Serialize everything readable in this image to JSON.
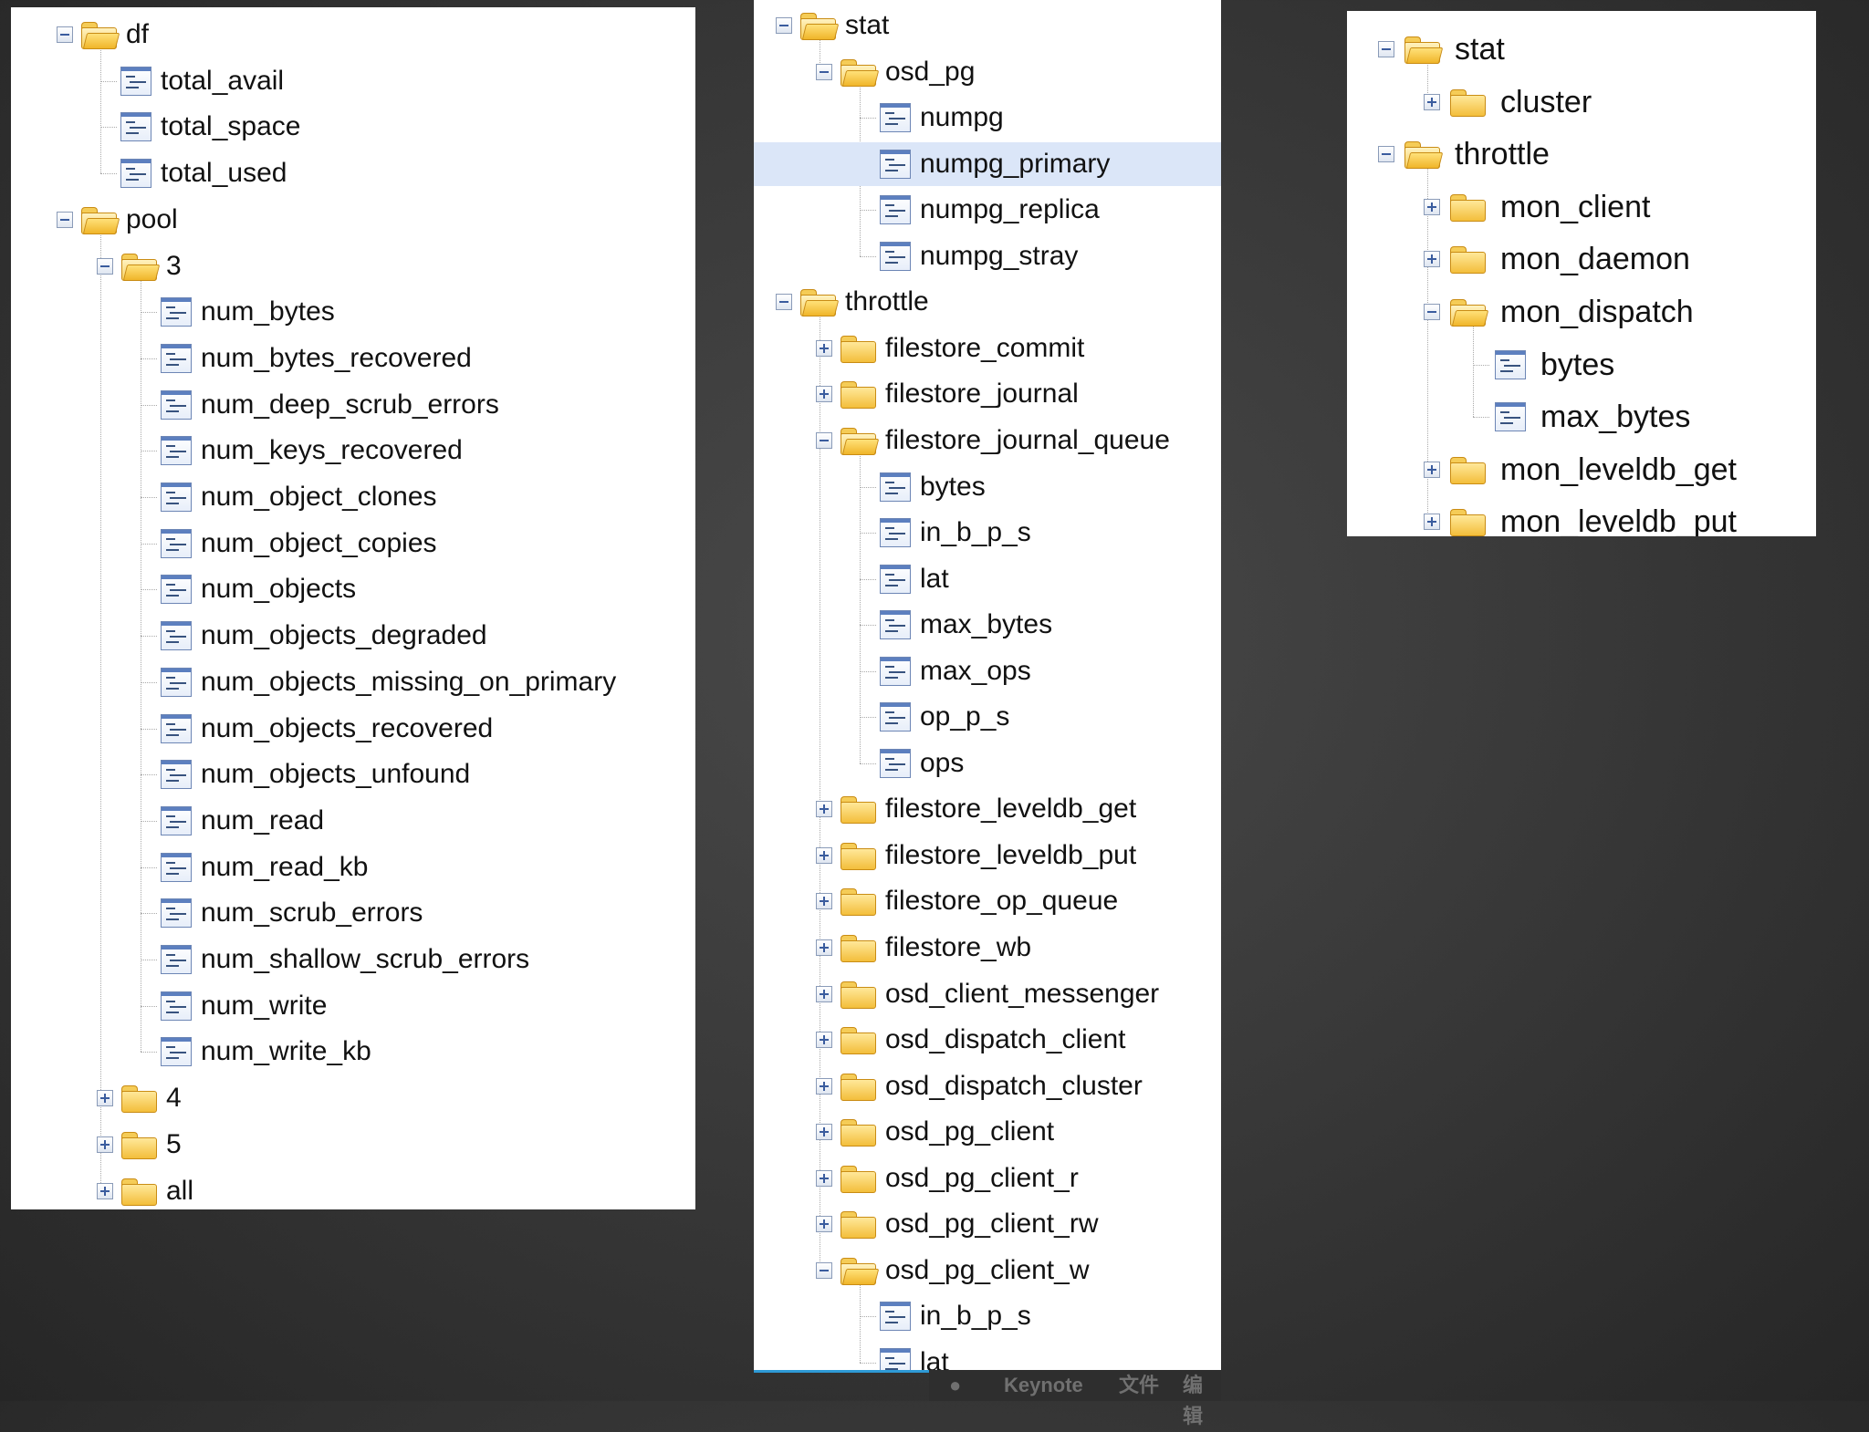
{
  "panels": [
    {
      "id": "panel-1",
      "rows": [
        {
          "label": "df",
          "type": "folder",
          "depth": 0,
          "toggle": "minus"
        },
        {
          "label": "total_avail",
          "type": "file",
          "depth": 1
        },
        {
          "label": "total_space",
          "type": "file",
          "depth": 1
        },
        {
          "label": "total_used",
          "type": "file",
          "depth": 1
        },
        {
          "label": "pool",
          "type": "folder",
          "depth": 0,
          "toggle": "minus"
        },
        {
          "label": "3",
          "type": "folder",
          "depth": 1,
          "toggle": "minus"
        },
        {
          "label": "num_bytes",
          "type": "file",
          "depth": 2
        },
        {
          "label": "num_bytes_recovered",
          "type": "file",
          "depth": 2
        },
        {
          "label": "num_deep_scrub_errors",
          "type": "file",
          "depth": 2
        },
        {
          "label": "num_keys_recovered",
          "type": "file",
          "depth": 2
        },
        {
          "label": "num_object_clones",
          "type": "file",
          "depth": 2
        },
        {
          "label": "num_object_copies",
          "type": "file",
          "depth": 2
        },
        {
          "label": "num_objects",
          "type": "file",
          "depth": 2
        },
        {
          "label": "num_objects_degraded",
          "type": "file",
          "depth": 2
        },
        {
          "label": "num_objects_missing_on_primary",
          "type": "file",
          "depth": 2
        },
        {
          "label": "num_objects_recovered",
          "type": "file",
          "depth": 2
        },
        {
          "label": "num_objects_unfound",
          "type": "file",
          "depth": 2
        },
        {
          "label": "num_read",
          "type": "file",
          "depth": 2
        },
        {
          "label": "num_read_kb",
          "type": "file",
          "depth": 2
        },
        {
          "label": "num_scrub_errors",
          "type": "file",
          "depth": 2
        },
        {
          "label": "num_shallow_scrub_errors",
          "type": "file",
          "depth": 2
        },
        {
          "label": "num_write",
          "type": "file",
          "depth": 2
        },
        {
          "label": "num_write_kb",
          "type": "file",
          "depth": 2
        },
        {
          "label": "4",
          "type": "folder",
          "depth": 1,
          "toggle": "plus"
        },
        {
          "label": "5",
          "type": "folder",
          "depth": 1,
          "toggle": "plus"
        },
        {
          "label": "all",
          "type": "folder",
          "depth": 1,
          "toggle": "plus"
        }
      ]
    },
    {
      "id": "panel-2",
      "rows": [
        {
          "label": "stat",
          "type": "folder",
          "depth": 0,
          "toggle": "minus"
        },
        {
          "label": "osd_pg",
          "type": "folder",
          "depth": 1,
          "toggle": "minus"
        },
        {
          "label": "numpg",
          "type": "file",
          "depth": 2
        },
        {
          "label": "numpg_primary",
          "type": "file",
          "depth": 2,
          "selected": true
        },
        {
          "label": "numpg_replica",
          "type": "file",
          "depth": 2
        },
        {
          "label": "numpg_stray",
          "type": "file",
          "depth": 2
        },
        {
          "label": "throttle",
          "type": "folder",
          "depth": 0,
          "toggle": "minus"
        },
        {
          "label": "filestore_commit",
          "type": "folder",
          "depth": 1,
          "toggle": "plus"
        },
        {
          "label": "filestore_journal",
          "type": "folder",
          "depth": 1,
          "toggle": "plus"
        },
        {
          "label": "filestore_journal_queue",
          "type": "folder",
          "depth": 1,
          "toggle": "minus"
        },
        {
          "label": "bytes",
          "type": "file",
          "depth": 2
        },
        {
          "label": "in_b_p_s",
          "type": "file",
          "depth": 2
        },
        {
          "label": "lat",
          "type": "file",
          "depth": 2
        },
        {
          "label": "max_bytes",
          "type": "file",
          "depth": 2
        },
        {
          "label": "max_ops",
          "type": "file",
          "depth": 2
        },
        {
          "label": "op_p_s",
          "type": "file",
          "depth": 2
        },
        {
          "label": "ops",
          "type": "file",
          "depth": 2
        },
        {
          "label": "filestore_leveldb_get",
          "type": "folder",
          "depth": 1,
          "toggle": "plus"
        },
        {
          "label": "filestore_leveldb_put",
          "type": "folder",
          "depth": 1,
          "toggle": "plus"
        },
        {
          "label": "filestore_op_queue",
          "type": "folder",
          "depth": 1,
          "toggle": "plus"
        },
        {
          "label": "filestore_wb",
          "type": "folder",
          "depth": 1,
          "toggle": "plus"
        },
        {
          "label": "osd_client_messenger",
          "type": "folder",
          "depth": 1,
          "toggle": "plus"
        },
        {
          "label": "osd_dispatch_client",
          "type": "folder",
          "depth": 1,
          "toggle": "plus"
        },
        {
          "label": "osd_dispatch_cluster",
          "type": "folder",
          "depth": 1,
          "toggle": "plus"
        },
        {
          "label": "osd_pg_client",
          "type": "folder",
          "depth": 1,
          "toggle": "plus"
        },
        {
          "label": "osd_pg_client_r",
          "type": "folder",
          "depth": 1,
          "toggle": "plus"
        },
        {
          "label": "osd_pg_client_rw",
          "type": "folder",
          "depth": 1,
          "toggle": "plus"
        },
        {
          "label": "osd_pg_client_w",
          "type": "folder",
          "depth": 1,
          "toggle": "minus"
        },
        {
          "label": "in_b_p_s",
          "type": "file",
          "depth": 2
        },
        {
          "label": "lat",
          "type": "file",
          "depth": 2
        }
      ]
    },
    {
      "id": "panel-3",
      "rows": [
        {
          "label": "stat",
          "type": "folder",
          "depth": 0,
          "toggle": "minus"
        },
        {
          "label": "cluster",
          "type": "folder",
          "depth": 1,
          "toggle": "plus"
        },
        {
          "label": "throttle",
          "type": "folder",
          "depth": 0,
          "toggle": "minus"
        },
        {
          "label": "mon_client",
          "type": "folder",
          "depth": 1,
          "toggle": "plus"
        },
        {
          "label": "mon_daemon",
          "type": "folder",
          "depth": 1,
          "toggle": "plus"
        },
        {
          "label": "mon_dispatch",
          "type": "folder",
          "depth": 1,
          "toggle": "minus"
        },
        {
          "label": "bytes",
          "type": "file",
          "depth": 2
        },
        {
          "label": "max_bytes",
          "type": "file",
          "depth": 2
        },
        {
          "label": "mon_leveldb_get",
          "type": "folder",
          "depth": 1,
          "toggle": "plus"
        },
        {
          "label": "mon_leveldb_put",
          "type": "folder",
          "depth": 1,
          "toggle": "plus"
        }
      ]
    }
  ],
  "dock": {
    "app_name": "Keynote",
    "menu_file": "文件",
    "menu_edit": "编辑"
  }
}
